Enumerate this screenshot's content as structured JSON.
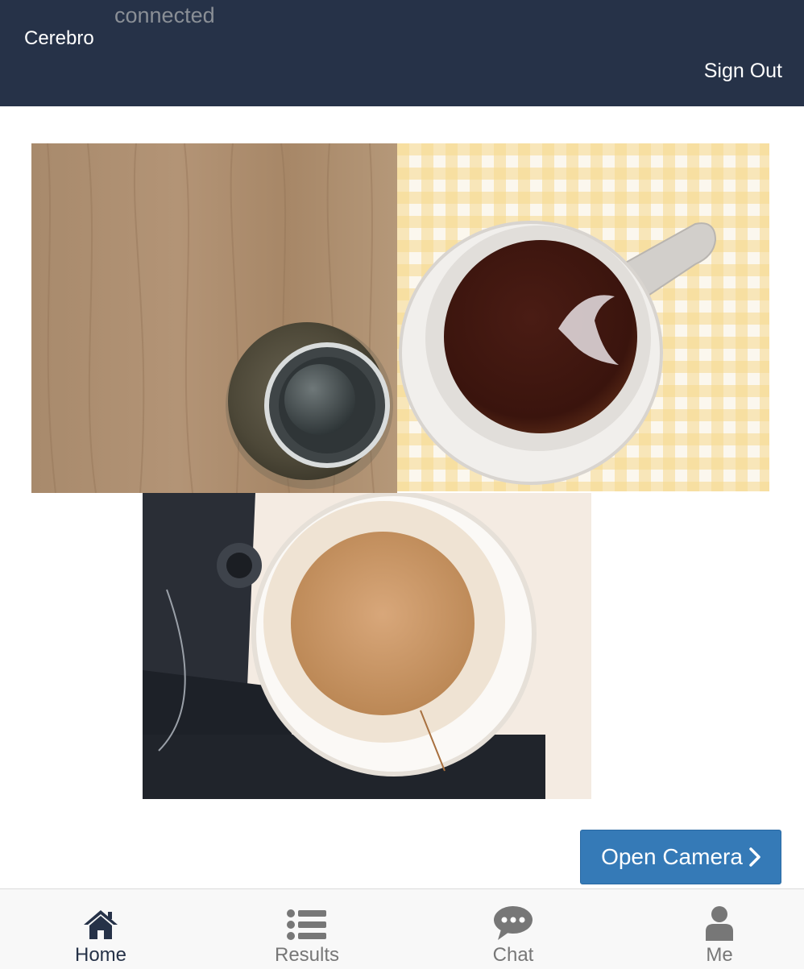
{
  "header": {
    "brand": "Cerebro",
    "status": "connected",
    "sign_out": "Sign Out"
  },
  "main": {
    "photos": [
      {
        "subject": "wooden-table-with-bottle"
      },
      {
        "subject": "black-coffee-mug-on-checkered-cloth"
      },
      {
        "subject": "latte-paper-cup"
      }
    ],
    "open_camera_label": "Open Camera"
  },
  "nav": {
    "tabs": [
      {
        "label": "Home",
        "icon": "home-icon",
        "active": true
      },
      {
        "label": "Results",
        "icon": "list-icon",
        "active": false
      },
      {
        "label": "Chat",
        "icon": "chat-bubble-icon",
        "active": false
      },
      {
        "label": "Me",
        "icon": "user-icon",
        "active": false
      }
    ]
  },
  "colors": {
    "header_bg": "#263248",
    "status_text": "#8a8f96",
    "button_bg": "#357ab7",
    "nav_active": "#263248",
    "nav_inactive": "#777777"
  }
}
